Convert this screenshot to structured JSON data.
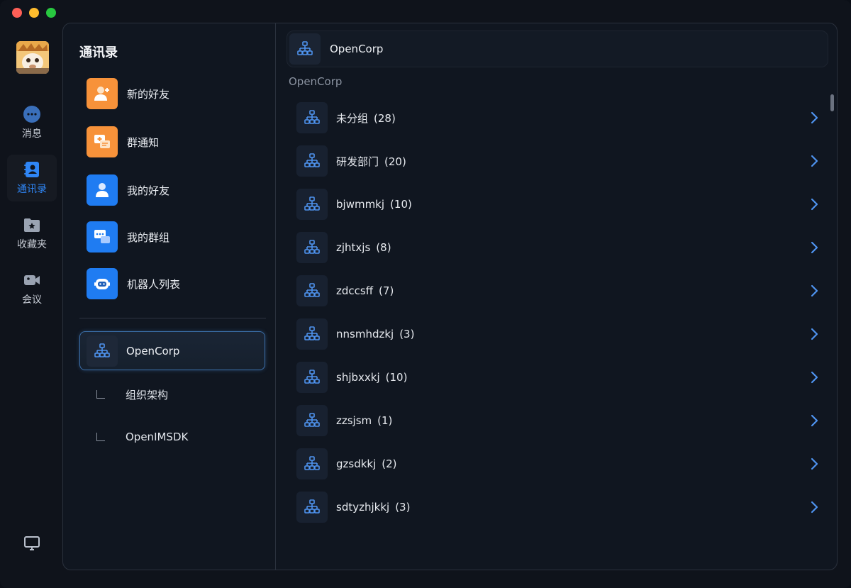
{
  "nav": {
    "items": [
      {
        "label": "消息",
        "icon": "chat-bubble-icon"
      },
      {
        "label": "通讯录",
        "icon": "contacts-icon",
        "active": true
      },
      {
        "label": "收藏夹",
        "icon": "favorites-folder-icon"
      },
      {
        "label": "会议",
        "icon": "video-camera-icon"
      }
    ]
  },
  "contacts": {
    "title": "通讯录",
    "categories": [
      {
        "label": "新的好友",
        "icon": "new-friend-icon",
        "color": "#f7923a"
      },
      {
        "label": "群通知",
        "icon": "group-notice-icon",
        "color": "#f7923a"
      },
      {
        "label": "我的好友",
        "icon": "my-friends-icon",
        "color": "#1f7cf2"
      },
      {
        "label": "我的群组",
        "icon": "my-groups-icon",
        "color": "#1f7cf2"
      },
      {
        "label": "机器人列表",
        "icon": "robot-icon",
        "color": "#1f7cf2"
      }
    ],
    "organization": {
      "name": "OpenCorp",
      "children": [
        "组织架构",
        "OpenIMSDK"
      ]
    }
  },
  "org_view": {
    "header": "OpenCorp",
    "section_label": "OpenCorp",
    "departments": [
      {
        "name": "未分组",
        "count": "(28)"
      },
      {
        "name": "研发部门",
        "count": "(20)"
      },
      {
        "name": "bjwmmkj",
        "count": "(10)"
      },
      {
        "name": "zjhtxjs",
        "count": "(8)"
      },
      {
        "name": "zdccsff",
        "count": "(7)"
      },
      {
        "name": "nnsmhdzkj",
        "count": "(3)"
      },
      {
        "name": "shjbxxkj",
        "count": "(10)"
      },
      {
        "name": "zzsjsm",
        "count": "(1)"
      },
      {
        "name": "gzsdkkj",
        "count": "(2)"
      },
      {
        "name": "sdtyzhjkkj",
        "count": "(3)"
      }
    ]
  },
  "colors": {
    "accent": "#2f86f6",
    "orange": "#f7923a",
    "blue": "#1f7cf2"
  }
}
